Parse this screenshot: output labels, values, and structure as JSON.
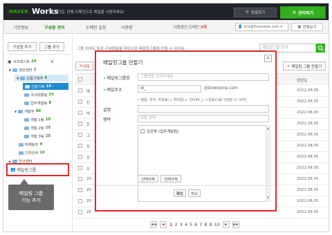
{
  "header": {
    "logo_naver": "NAVER",
    "logo_works": "Works",
    "tagline": "기업, 단체 도메인으로 메일을 사용하세요!",
    "register_label": "등록하기",
    "admin_label": "관리하기"
  },
  "nav": {
    "tabs": [
      {
        "label": "기본정보",
        "active": false
      },
      {
        "label": "구성원 관리",
        "active": true
      },
      {
        "label": "도메인 설정",
        "active": false
      },
      {
        "label": "사용량",
        "active": false
      }
    ],
    "domain_label_prefix": "이용중인 도메인",
    "domain_count": "3개",
    "domain_value": "one@fivrecione.com",
    "fullview_label": "전체보기"
  },
  "sidebar": {
    "add_member_label": "구성원 추가",
    "add_group_label": "그룹 추가",
    "items": [
      {
        "label": "이즈테시피",
        "count": "24"
      },
      {
        "label": "생산센터",
        "count": "2"
      },
      {
        "label": "상품기획부",
        "count": "4"
      },
      {
        "label": "신발기획",
        "count": "14"
      },
      {
        "label": "국내유통팀",
        "count": "23"
      },
      {
        "label": "업무개발팀",
        "count": "8"
      },
      {
        "label": "개발부",
        "count": "60"
      },
      {
        "label": "개발 1팀",
        "count": "10"
      },
      {
        "label": "개발 2팀",
        "count": "25"
      },
      {
        "label": "개발 3팀",
        "count": "25"
      },
      {
        "label": "마케팅부",
        "count": "9"
      },
      {
        "label": "디자인부",
        "count": "10"
      },
      {
        "label": "연구센터",
        "count": ""
      }
    ],
    "mailing_group_label": "메일링그룹"
  },
  "callout": {
    "line1": "메일링 그룹",
    "line2": "기능 추가"
  },
  "list": {
    "top_note": "그룹 외에도 특정 구성원들을 대상으로 메일링그룹을 만들 수 있어요.",
    "search_placeholder": "메일링그룹 검색",
    "delete_label": "삭제",
    "create_group_label": "메일링 그룹 만들기",
    "date_header": "생성일",
    "rows": [
      {
        "name": "메",
        "date": "2022.08.05"
      },
      {
        "name": "신",
        "date": "2022.08.05"
      },
      {
        "name": "비",
        "date": "2022.08.05"
      },
      {
        "name": "모",
        "date": "2022.08.05"
      },
      {
        "name": "고",
        "date": "2022.08.05"
      },
      {
        "name": "모",
        "date": "2022.08.05"
      },
      {
        "name": "모",
        "date": "2022.08.05"
      },
      {
        "name": "오",
        "date": "2022.08.05"
      },
      {
        "name": "20",
        "date": "2022.08.05"
      },
      {
        "name": "20",
        "date": "2022.08.05"
      },
      {
        "name": "20",
        "date": "2022.08.05"
      },
      {
        "name": "20",
        "date": "2022.08.05"
      }
    ]
  },
  "pager": {
    "pages": [
      "1",
      "2",
      "3",
      "4",
      "5",
      "6",
      "7",
      "8",
      "9",
      "10"
    ],
    "current": "1",
    "prev": "◀",
    "first": "◀◀",
    "next": "▶",
    "last": "▶▶"
  },
  "modal": {
    "title": "메일링그룹 만들기",
    "close": "×",
    "name_label": "메일링그룹명",
    "name_placeholder": "그룹명을 입력하세요.",
    "email_label": "메일주소",
    "email_value": "dl_",
    "email_suffix": "@slowlyone.com",
    "email_hint": "• 영문, 숫자, 마침표(.), 하이픈(-), 언더바(_), 느낌표(!)로 구성된 2~20자",
    "desc_label": "설명",
    "member_label": "멤버",
    "member_placeholder": "이름 검색",
    "member_item": "김강동 (업무개발팀)",
    "remove_selected_label": "선택삭제",
    "remove_all_label": "전체삭제",
    "confirm_label": "확인",
    "cancel_label": "취소"
  }
}
